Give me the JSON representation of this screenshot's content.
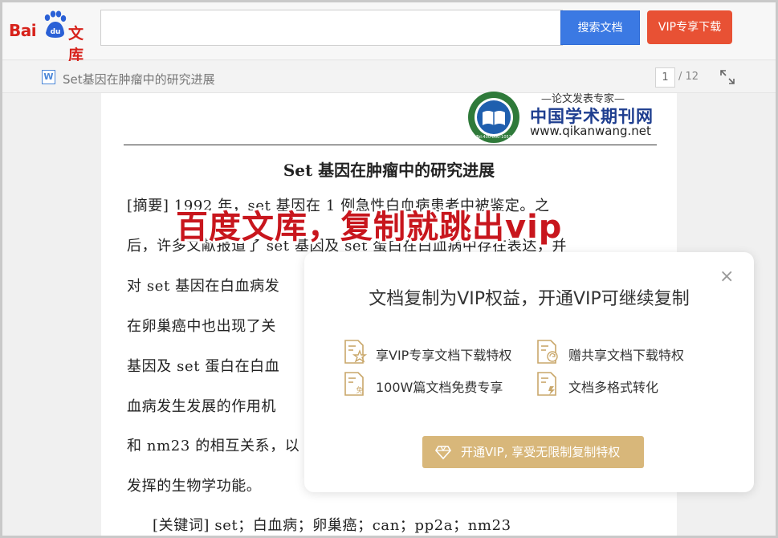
{
  "header": {
    "logo_bai": "Bai",
    "logo_du": "du",
    "logo_wenku": "文库",
    "search": {
      "value": "",
      "placeholder": ""
    },
    "search_button": "搜索文档",
    "vip_download_button": "VIP专享下载"
  },
  "docbar": {
    "doc_type_icon": "W",
    "title": "Set基因在肿瘤中的研究进展",
    "current_page": "1",
    "total_pages": "/ 12"
  },
  "document": {
    "stamp": {
      "slogan": "—论文发表专家—",
      "site_name": "中国学术期刊网",
      "site_url": "www.qikanwang.net",
      "seal_text": "Tel:400-800-1053"
    },
    "paper_title": "Set 基因在肿瘤中的研究进展",
    "lines": [
      "[摘要] 1992 年，set 基因在 1 例急性白血病患者中被鉴定。之",
      "后，许多文献报道了 set 基因及 set 蛋白在白血病中存在表达，并",
      "对 set 基因在白血病发",
      "在卵巢癌中也出现了关",
      "基因及 set 蛋白在白血",
      "血病发生发展的作用机",
      "和 nm23 的相互关系，以",
      "发挥的生物学功能。",
      "[关键词] set；白血病；卵巢癌；can；pp2a；nm23"
    ]
  },
  "overlay_headline": "百度文库，复制就跳出vip",
  "modal": {
    "title": "文档复制为VIP权益，开通VIP可继续复制",
    "close_symbol": "×",
    "features": [
      {
        "icon": "star-document-icon",
        "label": "享VIP专享文档下载特权"
      },
      {
        "icon": "share-document-icon",
        "label": "赠共享文档下载特权"
      },
      {
        "icon": "free-document-icon",
        "label": "100W篇文档免费专享"
      },
      {
        "icon": "convert-document-icon",
        "label": "文档多格式转化"
      }
    ],
    "free_badge": "免",
    "open_button": "开通VIP, 享受无限制复制特权"
  },
  "colors": {
    "brand_red": "#d7221b",
    "search_blue": "#3b79e3",
    "vip_orange": "#e85134",
    "headline_red": "#c8161d",
    "gold": "#d8b77a"
  }
}
